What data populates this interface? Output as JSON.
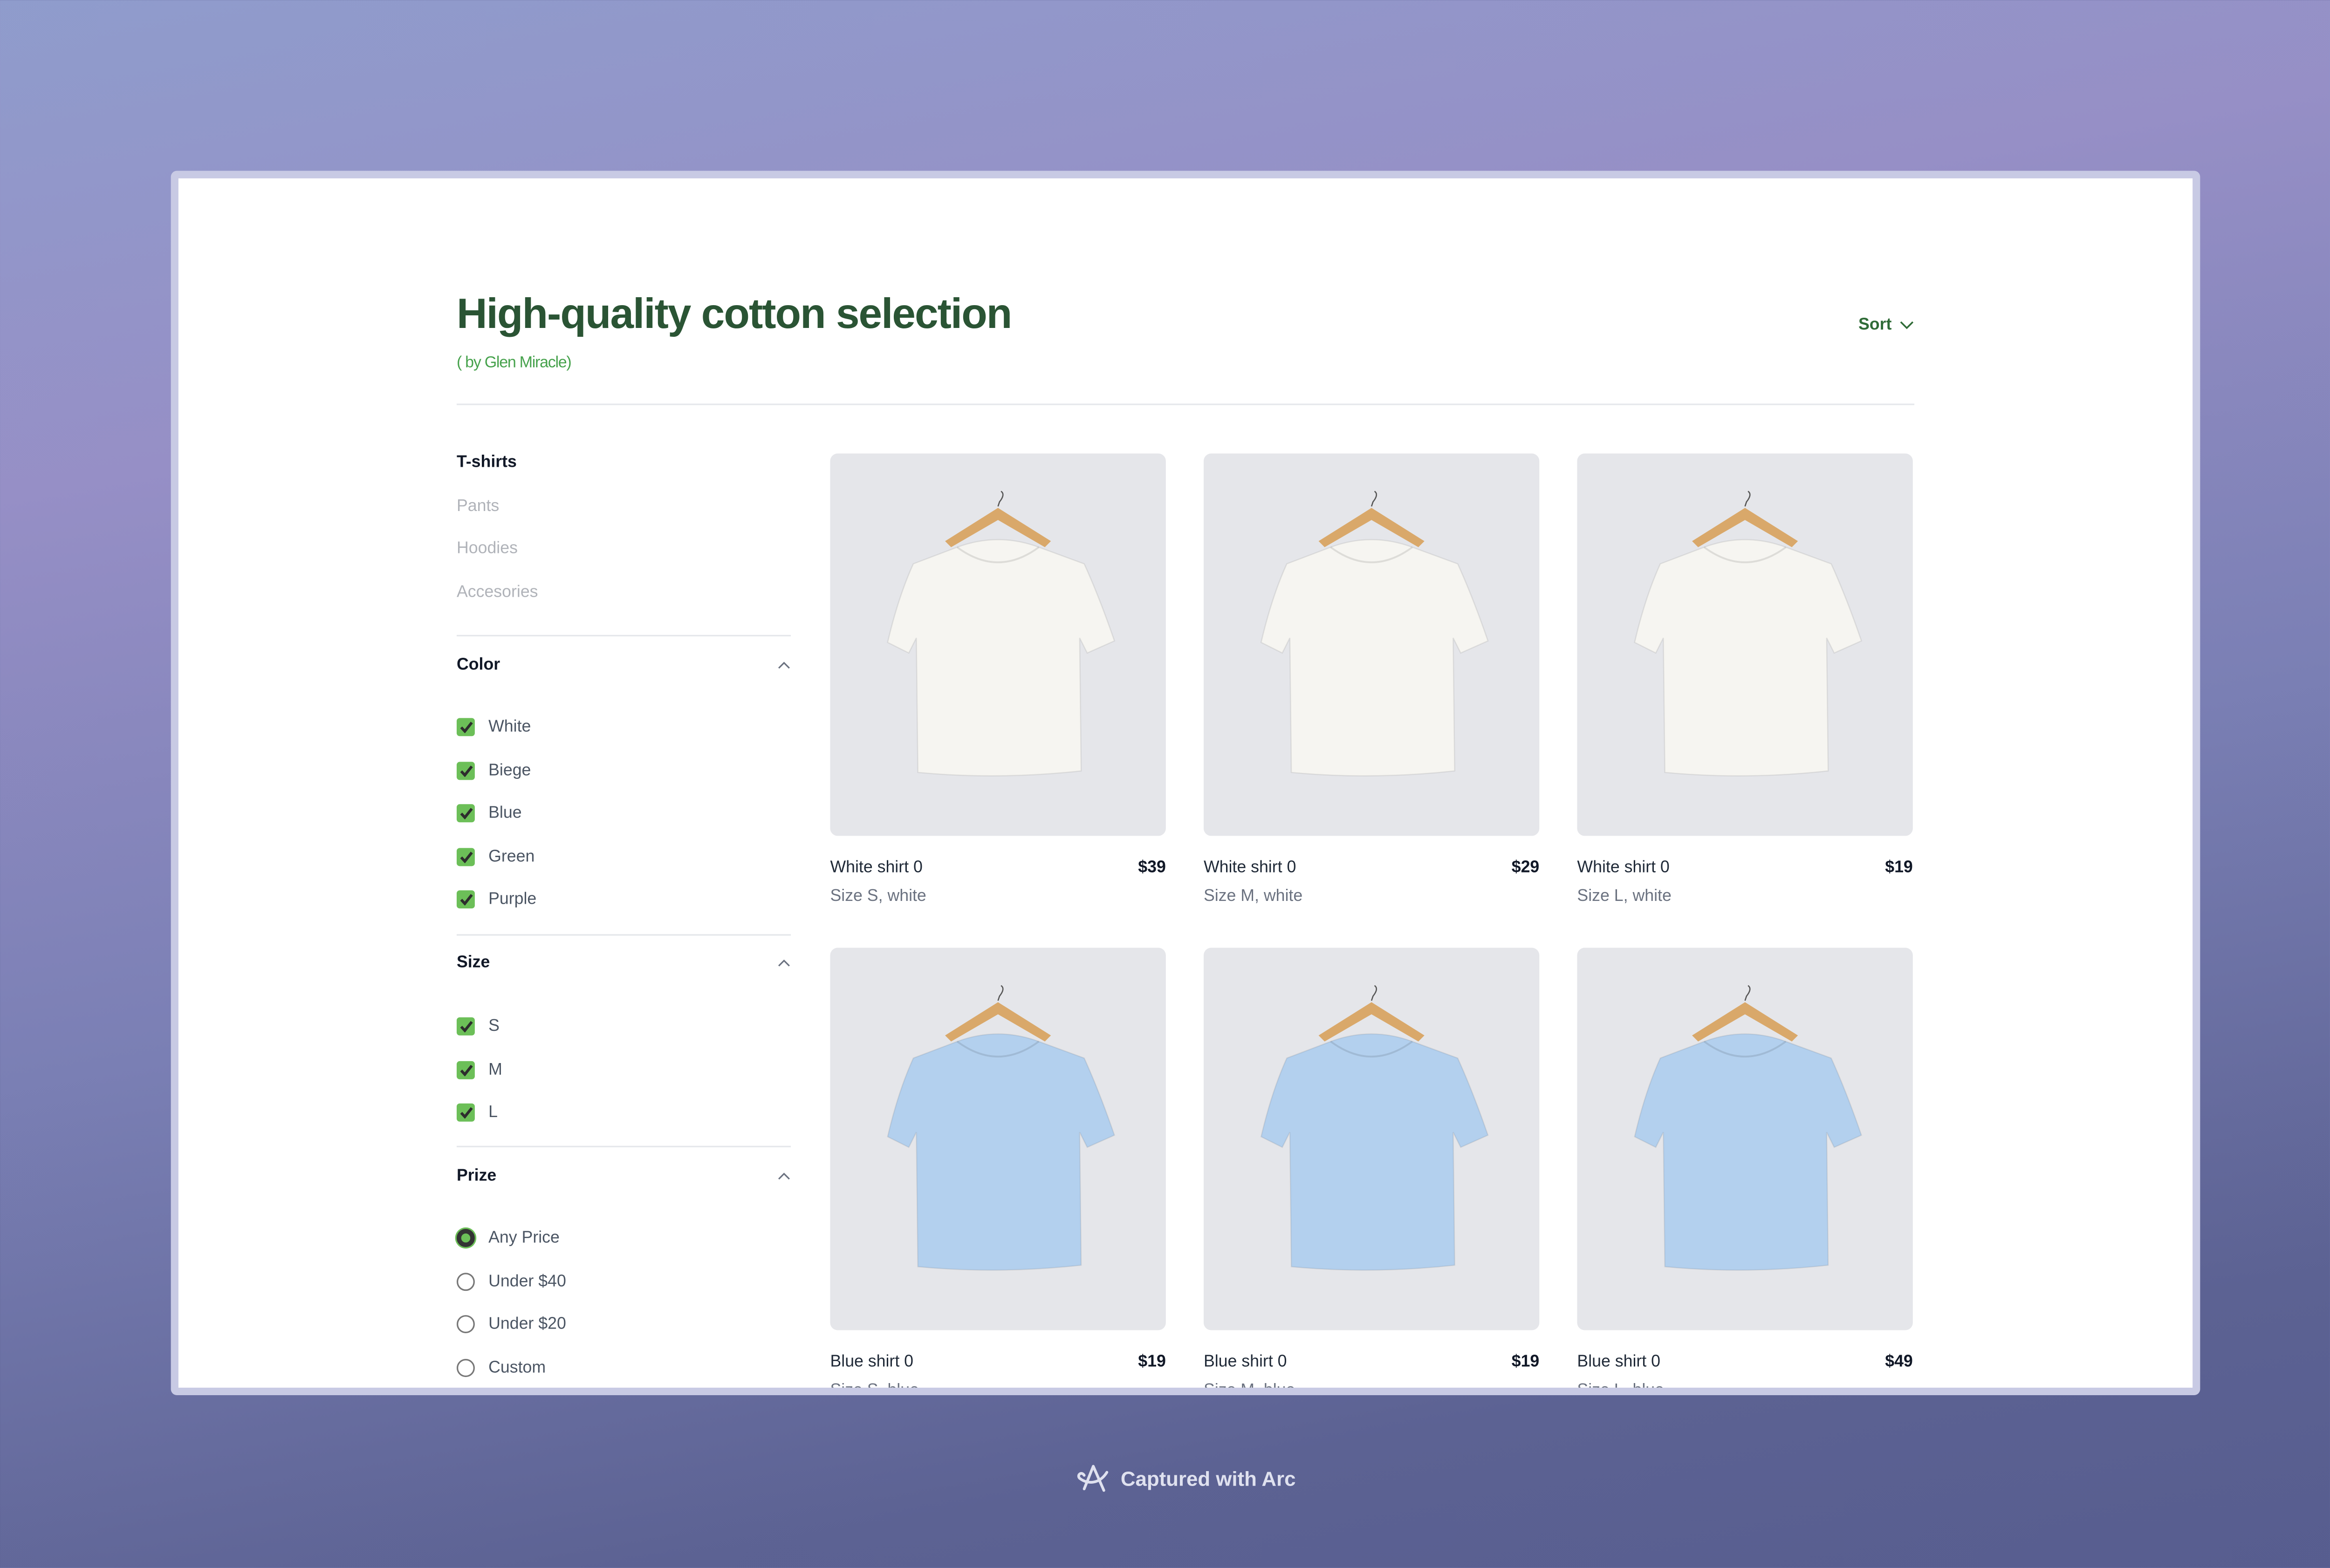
{
  "header": {
    "title": "High-quality cotton selection",
    "subtitle": "( by Glen Miracle)",
    "sort_label": "Sort"
  },
  "categories": [
    {
      "label": "T-shirts",
      "active": true
    },
    {
      "label": "Pants",
      "active": false
    },
    {
      "label": "Hoodies",
      "active": false
    },
    {
      "label": "Accesories",
      "active": false
    }
  ],
  "filters": {
    "color": {
      "title": "Color",
      "options": [
        {
          "label": "White",
          "checked": true
        },
        {
          "label": "Biege",
          "checked": true
        },
        {
          "label": "Blue",
          "checked": true
        },
        {
          "label": "Green",
          "checked": true
        },
        {
          "label": "Purple",
          "checked": true
        }
      ]
    },
    "size": {
      "title": "Size",
      "options": [
        {
          "label": "S",
          "checked": true
        },
        {
          "label": "M",
          "checked": true
        },
        {
          "label": "L",
          "checked": true
        }
      ]
    },
    "price": {
      "title": "Prize",
      "options": [
        {
          "label": "Any Price",
          "selected": true
        },
        {
          "label": "Under $40",
          "selected": false
        },
        {
          "label": "Under $20",
          "selected": false
        },
        {
          "label": "Custom",
          "selected": false
        }
      ]
    }
  },
  "products": [
    {
      "name": "White shirt 0",
      "price": "$39",
      "details": "Size S, white",
      "color": "#f6f5f1"
    },
    {
      "name": "White shirt 0",
      "price": "$29",
      "details": "Size M, white",
      "color": "#f6f5f1"
    },
    {
      "name": "White shirt 0",
      "price": "$19",
      "details": "Size L, white",
      "color": "#f6f5f1"
    },
    {
      "name": "Blue shirt 0",
      "price": "$19",
      "details": "Size S, blue",
      "color": "#b3d0ee"
    },
    {
      "name": "Blue shirt 0",
      "price": "$19",
      "details": "Size M, blue",
      "color": "#b3d0ee"
    },
    {
      "name": "Blue shirt 0",
      "price": "$49",
      "details": "Size L, blue",
      "color": "#b3d0ee"
    }
  ],
  "footer": {
    "label": "Captured with Arc"
  },
  "colors": {
    "accent": "#6cbf58",
    "title": "#2a5434",
    "subtitle": "#46a24c"
  }
}
